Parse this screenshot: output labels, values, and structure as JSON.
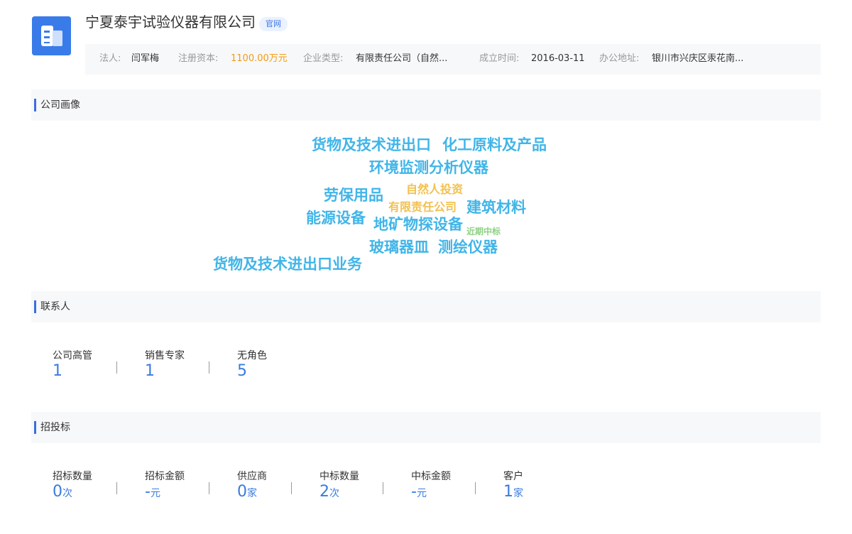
{
  "header": {
    "company_name": "宁夏泰宇试验仪器有限公司",
    "official_badge": "官网",
    "info": {
      "legal_person_label": "法人:",
      "legal_person_value": "闫军梅",
      "capital_label": "注册资本:",
      "capital_value": "1100.00万元",
      "type_label": "企业类型:",
      "type_value": "有限责任公司（自然...",
      "founded_label": "成立时间:",
      "founded_value": "2016-03-11",
      "address_label": "办公地址:",
      "address_value": "银川市兴庆区汞花南..."
    }
  },
  "portrait": {
    "title": "公司画像",
    "tags": [
      "货物及技术进出口",
      "化工原料及产品",
      "环境监测分析仪器",
      "劳保用品",
      "自然人投资",
      "有限责任公司",
      "建筑材料",
      "能源设备",
      "地矿物探设备",
      "近期中标",
      "玻璃器皿",
      "测绘仪器",
      "货物及技术进出口业务"
    ]
  },
  "contacts": {
    "title": "联系人",
    "stats": [
      {
        "label": "公司高管",
        "value": "1"
      },
      {
        "label": "销售专家",
        "value": "1"
      },
      {
        "label": "无角色",
        "value": "5"
      }
    ]
  },
  "bidding": {
    "title": "招投标",
    "stats": [
      {
        "label": "招标数量",
        "value": "0",
        "unit": "次"
      },
      {
        "label": "招标金额",
        "value": "-",
        "unit": "元"
      },
      {
        "label": "供应商",
        "value": "0",
        "unit": "家"
      },
      {
        "label": "中标数量",
        "value": "2",
        "unit": "次"
      },
      {
        "label": "中标金额",
        "value": "-",
        "unit": "元"
      },
      {
        "label": "客户",
        "value": "1",
        "unit": "家"
      }
    ]
  },
  "colors": {
    "accent": "#3a7bea",
    "tag_blue": "#41b5e8",
    "tag_yellow": "#f2c14f",
    "tag_green": "#8fd184",
    "capital_orange": "#f39c12"
  },
  "icons": {
    "logo": "building-logo-icon"
  }
}
